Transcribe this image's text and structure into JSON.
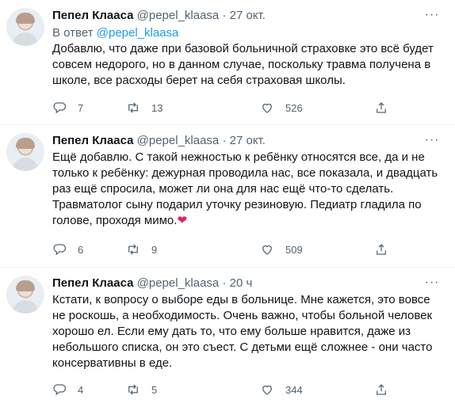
{
  "tweets": [
    {
      "author_name": "Пепел Клааса",
      "author_handle": "@pepel_klaasa",
      "separator": "·",
      "time": "27 окт.",
      "reply_prefix": "В ответ",
      "reply_mention": "@pepel_klaasa",
      "text": "Добавлю, что даже при базовой больничной страховке это всё будет совсем недорого, но в данном случае, поскольку травма получена в школе, все расходы берет на себя страховая школы.",
      "emoji": "",
      "replies": "7",
      "retweets": "13",
      "likes": "526"
    },
    {
      "author_name": "Пепел Клааса",
      "author_handle": "@pepel_klaasa",
      "separator": "·",
      "time": "27 окт.",
      "text": "Ещё добавлю. С такой нежностью к ребёнку относятся все, да и не только к ребёнку: дежурная проводила нас, все показала, и двадцать раз ещё спросила, может ли она для нас ещё что-то сделать. Травматолог сыну подарил уточку резиновую. Педиатр гладила по голове, проходя мимо.",
      "emoji": "❤",
      "replies": "6",
      "retweets": "9",
      "likes": "509"
    },
    {
      "author_name": "Пепел Клааса",
      "author_handle": "@pepel_klaasa",
      "separator": "·",
      "time": "20 ч",
      "text": "Кстати, к вопросу о выборе еды в больнице. Мне кажется, это вовсе не роскошь, а необходимость. Очень важно, чтобы больной человек хорошо ел. Если ему дать то, что ему больше нравится, даже из небольшого списка, он это съест. С детьми ещё сложнее - они часто консервативны в еде.",
      "emoji": "",
      "replies": "4",
      "retweets": "5",
      "likes": "344"
    }
  ],
  "more_icon": "more-horizontal-icon",
  "icons": {
    "reply": "reply-icon",
    "retweet": "retweet-icon",
    "like": "heart-icon",
    "share": "share-icon"
  },
  "colors": {
    "text": "#0f1419",
    "secondary": "#536471",
    "link": "#1d9bf0",
    "heart_emoji": "#e0245e",
    "divider": "#eff3f4"
  }
}
